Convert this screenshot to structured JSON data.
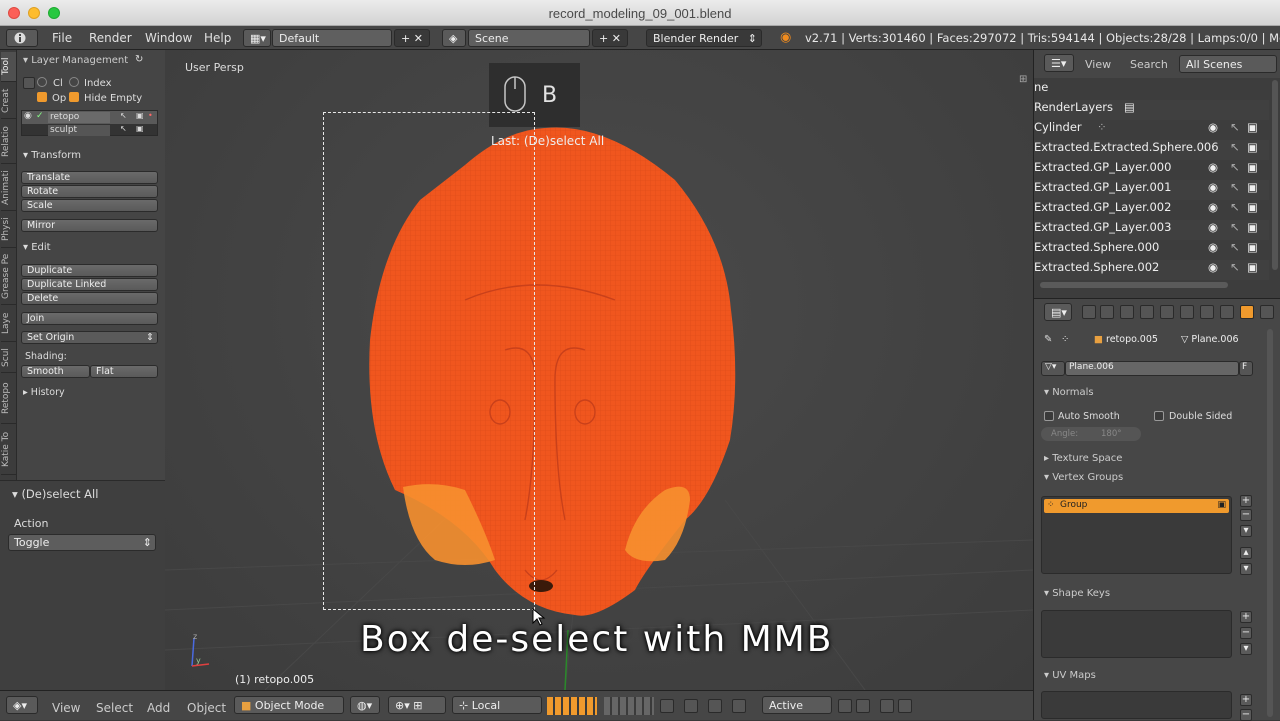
{
  "window": {
    "title": "record_modeling_09_001.blend"
  },
  "menu": {
    "file": "File",
    "render": "Render",
    "window": "Window",
    "help": "Help"
  },
  "header": {
    "layout": "Default",
    "scene": "Scene",
    "engine": "Blender Render",
    "stats": "v2.71 | Verts:301460 | Faces:297072 | Tris:594144 | Objects:28/28 | Lamps:0/0 | Mem:264"
  },
  "tabs": [
    "Tool",
    "Creat",
    "Relatio",
    "Animati",
    "Physi",
    "Grease Pe",
    "Laye",
    "Scul",
    "Retopo",
    "Katie To"
  ],
  "layer_panel": {
    "title": "Layer Management",
    "ci": "Cl",
    "index": "Index",
    "op": "Op",
    "hide_empty": "Hide Empty",
    "layers": [
      "retopo",
      "sculpt"
    ]
  },
  "transform": {
    "title": "Transform",
    "translate": "Translate",
    "rotate": "Rotate",
    "scale": "Scale",
    "mirror": "Mirror"
  },
  "edit": {
    "title": "Edit",
    "duplicate": "Duplicate",
    "duplicate_linked": "Duplicate Linked",
    "delete": "Delete",
    "join": "Join",
    "set_origin": "Set Origin",
    "shading": "Shading:",
    "smooth": "Smooth",
    "flat": "Flat"
  },
  "history": {
    "title": "History"
  },
  "operator": {
    "title": "(De)select All",
    "action_label": "Action",
    "action_value": "Toggle"
  },
  "viewport": {
    "view_label": "User Persp",
    "key": "B",
    "last_op": "Last: (De)select All",
    "caption": "Box de-select with MMB",
    "object_label": "(1) retopo.005"
  },
  "bottombar": {
    "view": "View",
    "select": "Select",
    "add": "Add",
    "object": "Object",
    "mode": "Object Mode",
    "orientation": "Local",
    "pivot": "Active"
  },
  "outliner": {
    "view": "View",
    "search": "Search",
    "scope": "All Scenes",
    "rows": [
      "ne",
      "RenderLayers",
      "Cylinder",
      "Extracted.Extracted.Sphere.006",
      "Extracted.GP_Layer.000",
      "Extracted.GP_Layer.001",
      "Extracted.GP_Layer.002",
      "Extracted.GP_Layer.003",
      "Extracted.Sphere.000",
      "Extracted.Sphere.002"
    ]
  },
  "properties": {
    "object": "retopo.005",
    "mesh": "Plane.006",
    "mesh_field": "Plane.006",
    "fake_user": "F",
    "normals": "Normals",
    "auto_smooth": "Auto Smooth",
    "double_sided": "Double Sided",
    "angle": "Angle:",
    "angle_value": "180°",
    "texture_space": "Texture Space",
    "vertex_groups": "Vertex Groups",
    "group": "Group",
    "shape_keys": "Shape Keys",
    "uv_maps": "UV Maps"
  },
  "colors": {
    "mesh": "#f0561e",
    "mesh_light": "#f7902f",
    "selection": "#f09a2d",
    "accent": "#f18c1e"
  }
}
